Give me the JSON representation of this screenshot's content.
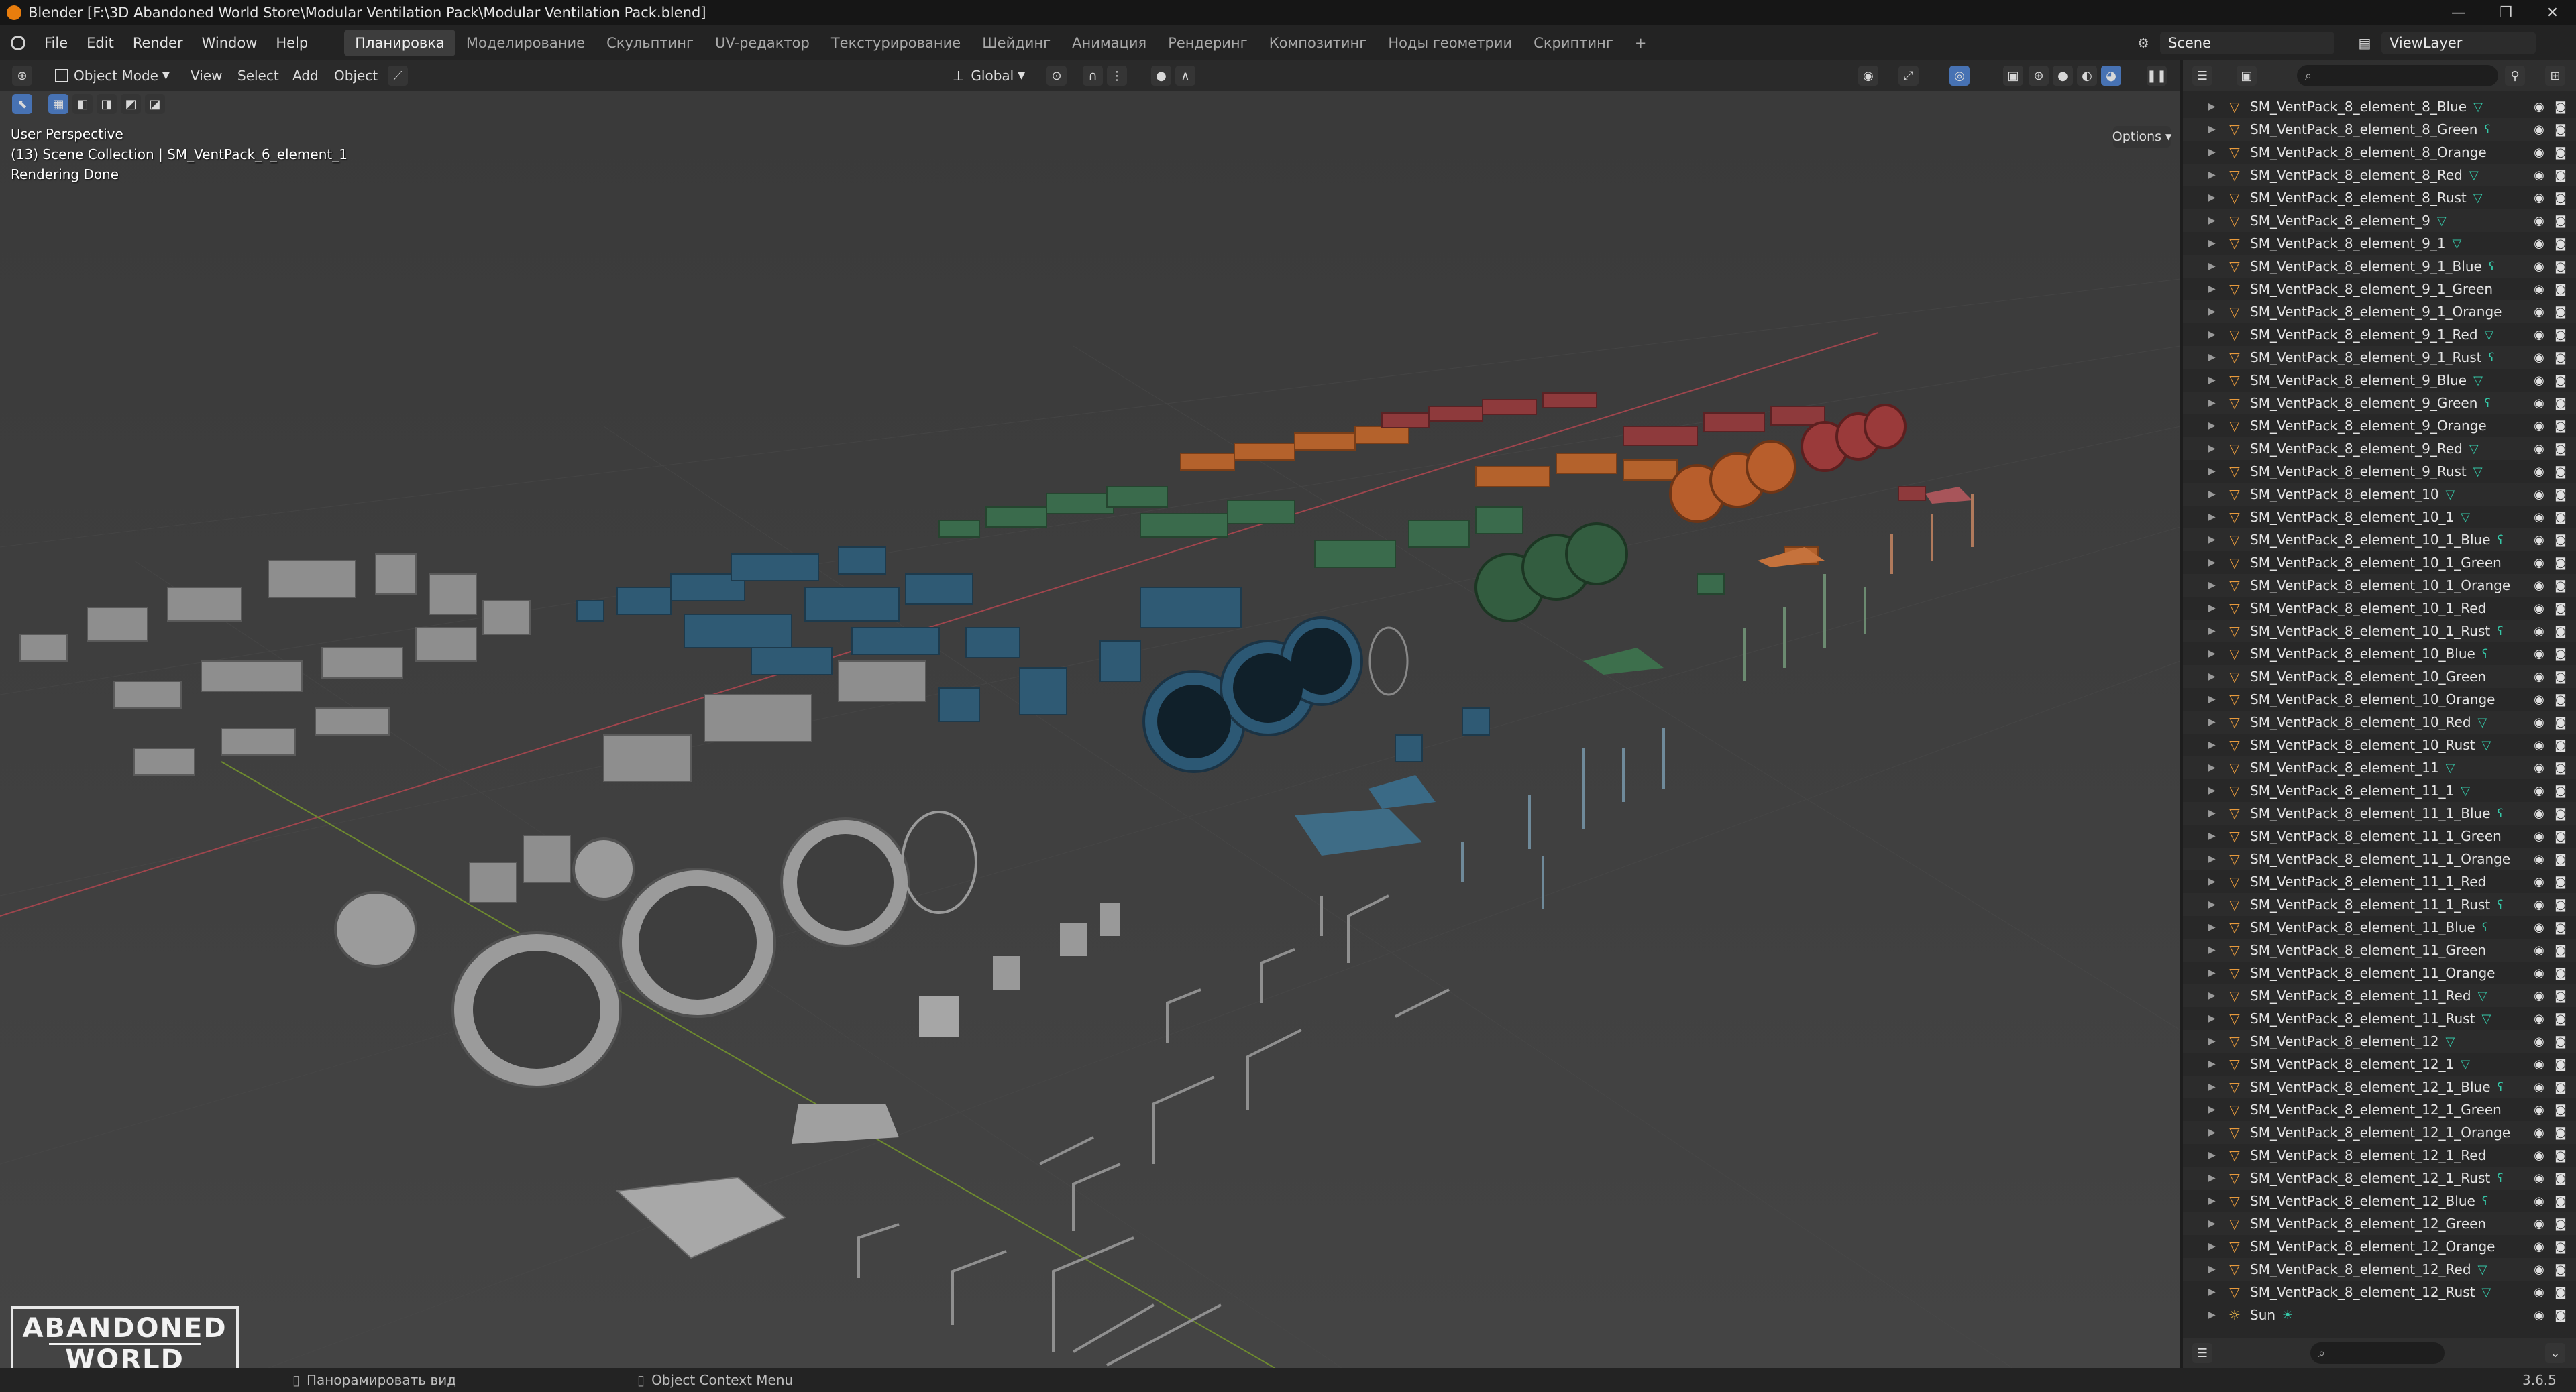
{
  "window": {
    "title": "Blender [F:\\3D Abandoned World Store\\Modular Ventilation Pack\\Modular Ventilation Pack.blend]",
    "controls": [
      "—",
      "❐",
      "✕"
    ]
  },
  "menu": {
    "items": [
      "File",
      "Edit",
      "Render",
      "Window",
      "Help"
    ],
    "workspaces": [
      "Планировка",
      "Моделирование",
      "Скульптинг",
      "UV-редактор",
      "Текстурирование",
      "Шейдинг",
      "Анимация",
      "Рендеринг",
      "Композитинг",
      "Ноды геометрии",
      "Скриптинг"
    ],
    "active_workspace": "Планировка",
    "add_workspace": "+",
    "scene": "Scene",
    "view_layer": "ViewLayer"
  },
  "viewport_header": {
    "mode": "Object Mode",
    "menus": [
      "View",
      "Select",
      "Add",
      "Object"
    ],
    "transform": "Global",
    "options": "Options"
  },
  "viewport_overlay": {
    "line1": "User Perspective",
    "line2": "(13) Scene Collection | SM_VentPack_6_element_1",
    "line3": "Rendering Done",
    "watermark_top": "ABANDONED",
    "watermark_bottom": "WORLD"
  },
  "outliner": {
    "rows": [
      {
        "name": "SM_VentPack_8_element_8_Blue",
        "mod": "▽"
      },
      {
        "name": "SM_VentPack_8_element_8_Green",
        "mod": "ʕ"
      },
      {
        "name": "SM_VentPack_8_element_8_Orange",
        "mod": ""
      },
      {
        "name": "SM_VentPack_8_element_8_Red",
        "mod": "▽"
      },
      {
        "name": "SM_VentPack_8_element_8_Rust",
        "mod": "▽"
      },
      {
        "name": "SM_VentPack_8_element_9",
        "mod": "▽"
      },
      {
        "name": "SM_VentPack_8_element_9_1",
        "mod": "▽"
      },
      {
        "name": "SM_VentPack_8_element_9_1_Blue",
        "mod": "ʕ"
      },
      {
        "name": "SM_VentPack_8_element_9_1_Green",
        "mod": ""
      },
      {
        "name": "SM_VentPack_8_element_9_1_Orange",
        "mod": ""
      },
      {
        "name": "SM_VentPack_8_element_9_1_Red",
        "mod": "▽"
      },
      {
        "name": "SM_VentPack_8_element_9_1_Rust",
        "mod": "ʕ"
      },
      {
        "name": "SM_VentPack_8_element_9_Blue",
        "mod": "▽"
      },
      {
        "name": "SM_VentPack_8_element_9_Green",
        "mod": "ʕ"
      },
      {
        "name": "SM_VentPack_8_element_9_Orange",
        "mod": ""
      },
      {
        "name": "SM_VentPack_8_element_9_Red",
        "mod": "▽"
      },
      {
        "name": "SM_VentPack_8_element_9_Rust",
        "mod": "▽"
      },
      {
        "name": "SM_VentPack_8_element_10",
        "mod": "▽"
      },
      {
        "name": "SM_VentPack_8_element_10_1",
        "mod": "▽"
      },
      {
        "name": "SM_VentPack_8_element_10_1_Blue",
        "mod": "ʕ"
      },
      {
        "name": "SM_VentPack_8_element_10_1_Green",
        "mod": ""
      },
      {
        "name": "SM_VentPack_8_element_10_1_Orange",
        "mod": ""
      },
      {
        "name": "SM_VentPack_8_element_10_1_Red",
        "mod": ""
      },
      {
        "name": "SM_VentPack_8_element_10_1_Rust",
        "mod": "ʕ"
      },
      {
        "name": "SM_VentPack_8_element_10_Blue",
        "mod": "ʕ"
      },
      {
        "name": "SM_VentPack_8_element_10_Green",
        "mod": ""
      },
      {
        "name": "SM_VentPack_8_element_10_Orange",
        "mod": ""
      },
      {
        "name": "SM_VentPack_8_element_10_Red",
        "mod": "▽"
      },
      {
        "name": "SM_VentPack_8_element_10_Rust",
        "mod": "▽"
      },
      {
        "name": "SM_VentPack_8_element_11",
        "mod": "▽"
      },
      {
        "name": "SM_VentPack_8_element_11_1",
        "mod": "▽"
      },
      {
        "name": "SM_VentPack_8_element_11_1_Blue",
        "mod": "ʕ"
      },
      {
        "name": "SM_VentPack_8_element_11_1_Green",
        "mod": ""
      },
      {
        "name": "SM_VentPack_8_element_11_1_Orange",
        "mod": ""
      },
      {
        "name": "SM_VentPack_8_element_11_1_Red",
        "mod": ""
      },
      {
        "name": "SM_VentPack_8_element_11_1_Rust",
        "mod": "ʕ"
      },
      {
        "name": "SM_VentPack_8_element_11_Blue",
        "mod": "ʕ"
      },
      {
        "name": "SM_VentPack_8_element_11_Green",
        "mod": ""
      },
      {
        "name": "SM_VentPack_8_element_11_Orange",
        "mod": ""
      },
      {
        "name": "SM_VentPack_8_element_11_Red",
        "mod": "▽"
      },
      {
        "name": "SM_VentPack_8_element_11_Rust",
        "mod": "▽"
      },
      {
        "name": "SM_VentPack_8_element_12",
        "mod": "▽"
      },
      {
        "name": "SM_VentPack_8_element_12_1",
        "mod": "▽"
      },
      {
        "name": "SM_VentPack_8_element_12_1_Blue",
        "mod": "ʕ"
      },
      {
        "name": "SM_VentPack_8_element_12_1_Green",
        "mod": ""
      },
      {
        "name": "SM_VentPack_8_element_12_1_Orange",
        "mod": ""
      },
      {
        "name": "SM_VentPack_8_element_12_1_Red",
        "mod": ""
      },
      {
        "name": "SM_VentPack_8_element_12_1_Rust",
        "mod": "ʕ"
      },
      {
        "name": "SM_VentPack_8_element_12_Blue",
        "mod": "ʕ"
      },
      {
        "name": "SM_VentPack_8_element_12_Green",
        "mod": ""
      },
      {
        "name": "SM_VentPack_8_element_12_Orange",
        "mod": ""
      },
      {
        "name": "SM_VentPack_8_element_12_Red",
        "mod": "▽"
      },
      {
        "name": "SM_VentPack_8_element_12_Rust",
        "mod": "▽"
      }
    ],
    "sun_row": {
      "name": "Sun"
    }
  },
  "status": {
    "pan_view": "Панорамировать вид",
    "context_menu": "Object Context Menu",
    "version": "3.6.5"
  },
  "colors": {
    "accent": "#e87d0d",
    "active_blue": "#4772b3",
    "modifier_teal": "#35c8a8"
  }
}
